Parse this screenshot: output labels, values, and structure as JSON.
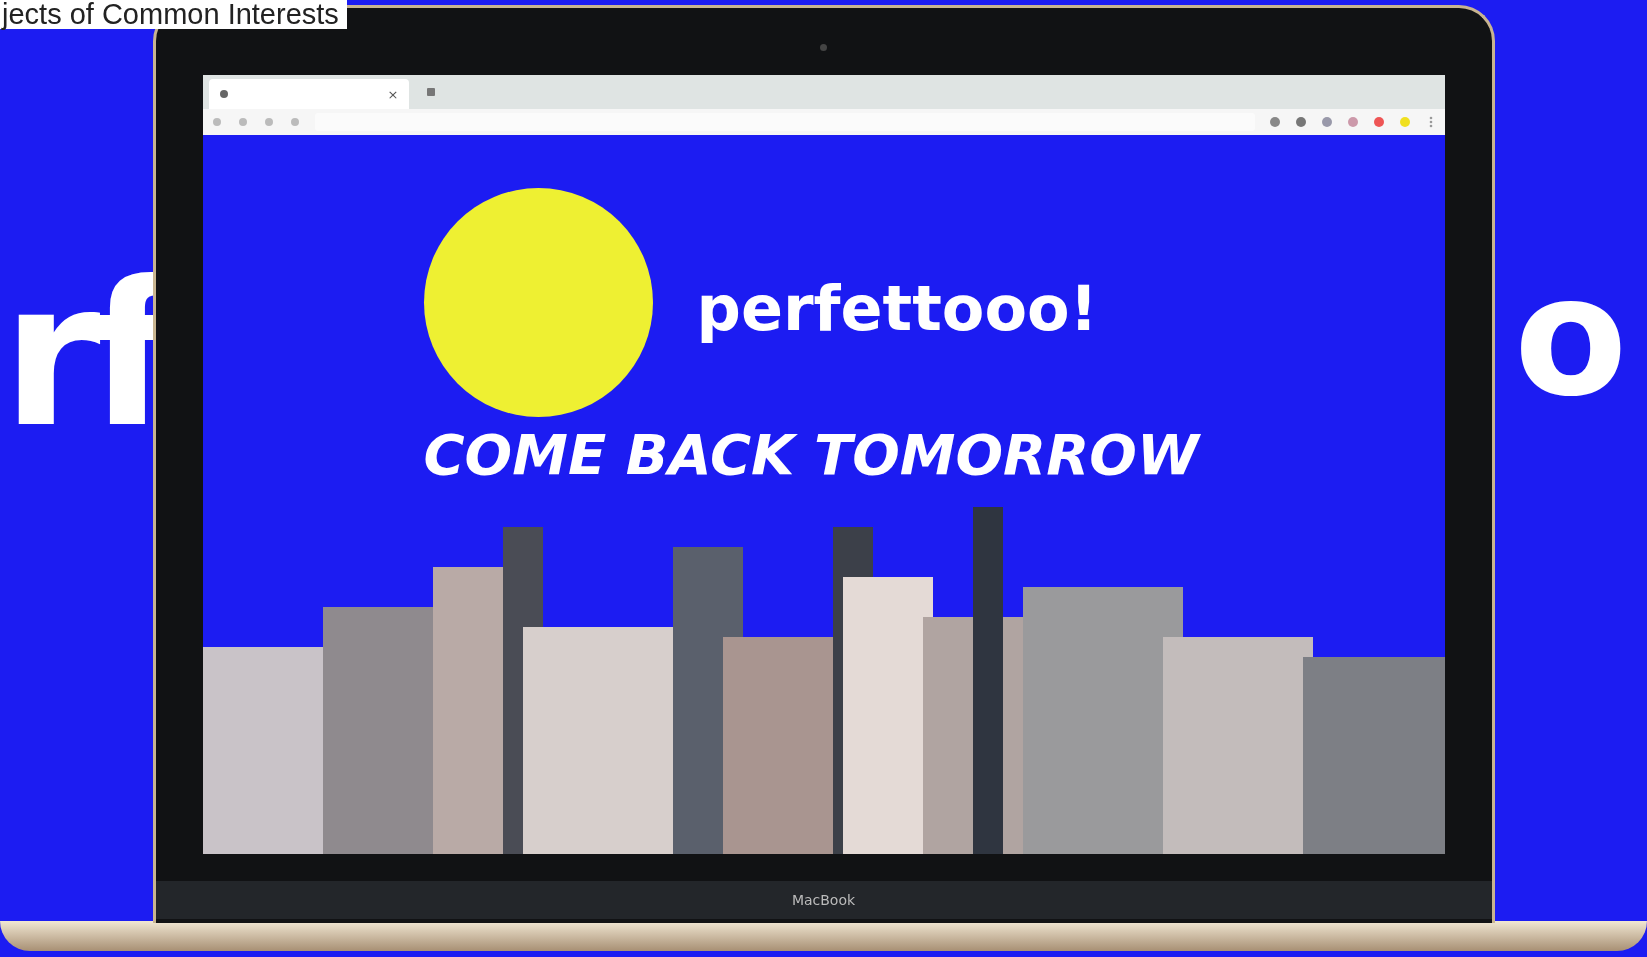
{
  "page_title": "jects of Common Interests",
  "backdrop_text": [
    "rf",
    "o"
  ],
  "browser": {
    "tab_close": "×"
  },
  "site": {
    "logo_text": "perfettooo!",
    "headline": "COME BACK TOMORROW"
  },
  "laptop": {
    "label": "MacBook"
  }
}
